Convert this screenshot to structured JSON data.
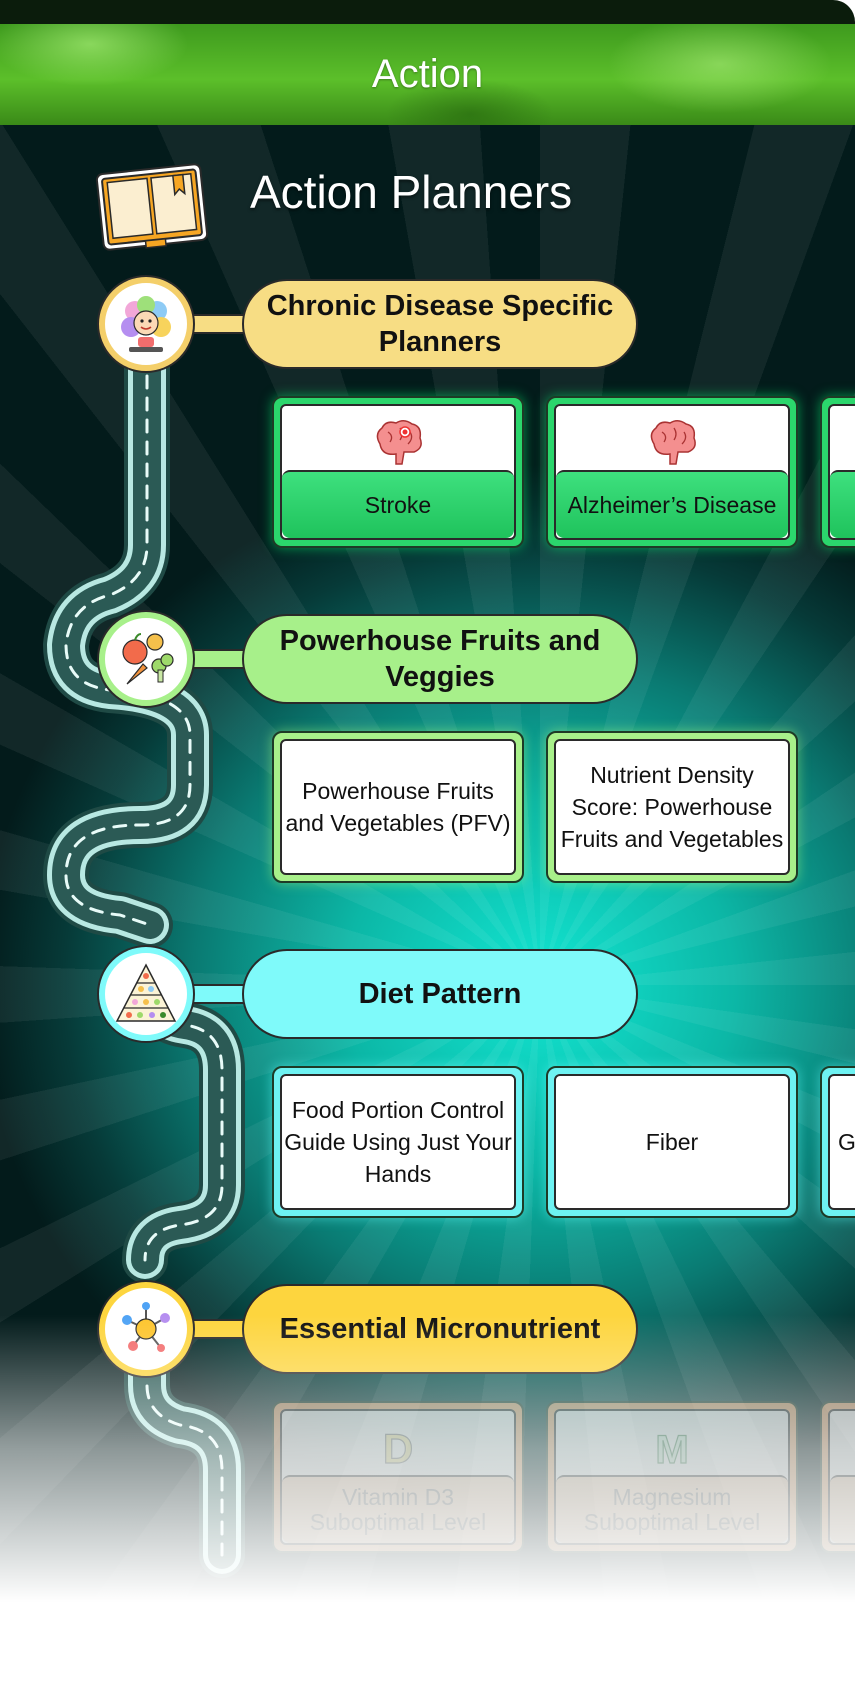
{
  "header": {
    "title": "Action"
  },
  "section": {
    "title": "Action Planners"
  },
  "groups": [
    {
      "title": "Chronic Disease Specific Planners",
      "icon": "flower-mascot-icon",
      "color": "#f7dd84",
      "cards": [
        {
          "label": "Stroke",
          "icon": "brain-icon"
        },
        {
          "label": "Alzheimer’s Disease",
          "icon": "brain-icon"
        }
      ]
    },
    {
      "title": "Powerhouse Fruits and Veggies",
      "icon": "fruits-veggies-icon",
      "color": "#a7f08a",
      "cards": [
        {
          "label": "Powerhouse Fruits and Vegetables (PFV)"
        },
        {
          "label": "Nutrient Density Score: Powerhouse Fruits and Vegetables"
        }
      ]
    },
    {
      "title": "Diet Pattern",
      "icon": "food-pyramid-icon",
      "color": "#7ffafa",
      "cards": [
        {
          "label": "Food Portion Control Guide Using Just Your Hands"
        },
        {
          "label": "Fiber"
        },
        {
          "label": "Go"
        }
      ]
    },
    {
      "title": "Essential Micronutrient",
      "icon": "molecule-icon",
      "color": "#fdd53e",
      "cards": [
        {
          "label": "Vitamin D3 Suboptimal Level",
          "icon": "letter-d-icon"
        },
        {
          "label": "Magnesium Suboptimal Level",
          "icon": "letter-m-icon"
        }
      ]
    }
  ]
}
